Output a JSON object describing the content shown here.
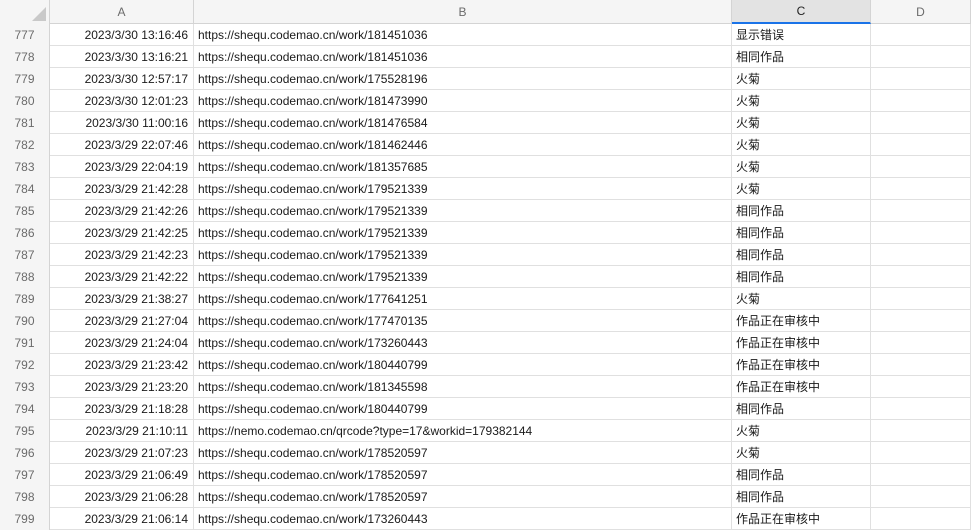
{
  "columns": [
    "A",
    "B",
    "C",
    "D"
  ],
  "rows": [
    {
      "num": "777",
      "a": "2023/3/30 13:16:46",
      "b": "https://shequ.codemao.cn/work/181451036",
      "c": "显示错误"
    },
    {
      "num": "778",
      "a": "2023/3/30 13:16:21",
      "b": "https://shequ.codemao.cn/work/181451036",
      "c": "相同作品"
    },
    {
      "num": "779",
      "a": "2023/3/30 12:57:17",
      "b": "https://shequ.codemao.cn/work/175528196",
      "c": "火菊"
    },
    {
      "num": "780",
      "a": "2023/3/30 12:01:23",
      "b": "https://shequ.codemao.cn/work/181473990",
      "c": "火菊"
    },
    {
      "num": "781",
      "a": "2023/3/30 11:00:16",
      "b": "https://shequ.codemao.cn/work/181476584",
      "c": "火菊"
    },
    {
      "num": "782",
      "a": "2023/3/29 22:07:46",
      "b": "https://shequ.codemao.cn/work/181462446",
      "c": "火菊"
    },
    {
      "num": "783",
      "a": "2023/3/29 22:04:19",
      "b": "https://shequ.codemao.cn/work/181357685",
      "c": "火菊"
    },
    {
      "num": "784",
      "a": "2023/3/29 21:42:28",
      "b": "https://shequ.codemao.cn/work/179521339",
      "c": "火菊"
    },
    {
      "num": "785",
      "a": "2023/3/29 21:42:26",
      "b": "https://shequ.codemao.cn/work/179521339",
      "c": "相同作品"
    },
    {
      "num": "786",
      "a": "2023/3/29 21:42:25",
      "b": "https://shequ.codemao.cn/work/179521339",
      "c": "相同作品"
    },
    {
      "num": "787",
      "a": "2023/3/29 21:42:23",
      "b": "https://shequ.codemao.cn/work/179521339",
      "c": "相同作品"
    },
    {
      "num": "788",
      "a": "2023/3/29 21:42:22",
      "b": "https://shequ.codemao.cn/work/179521339",
      "c": "相同作品"
    },
    {
      "num": "789",
      "a": "2023/3/29 21:38:27",
      "b": "https://shequ.codemao.cn/work/177641251",
      "c": "火菊"
    },
    {
      "num": "790",
      "a": "2023/3/29 21:27:04",
      "b": "https://shequ.codemao.cn/work/177470135",
      "c": "作品正在审核中"
    },
    {
      "num": "791",
      "a": "2023/3/29 21:24:04",
      "b": "https://shequ.codemao.cn/work/173260443",
      "c": "作品正在审核中"
    },
    {
      "num": "792",
      "a": "2023/3/29 21:23:42",
      "b": "https://shequ.codemao.cn/work/180440799",
      "c": "作品正在审核中"
    },
    {
      "num": "793",
      "a": "2023/3/29 21:23:20",
      "b": "https://shequ.codemao.cn/work/181345598",
      "c": "作品正在审核中"
    },
    {
      "num": "794",
      "a": "2023/3/29 21:18:28",
      "b": "https://shequ.codemao.cn/work/180440799",
      "c": "相同作品"
    },
    {
      "num": "795",
      "a": "2023/3/29 21:10:11",
      "b": "https://nemo.codemao.cn/qrcode?type=17&workid=179382144",
      "c": "火菊"
    },
    {
      "num": "796",
      "a": "2023/3/29 21:07:23",
      "b": "https://shequ.codemao.cn/work/178520597",
      "c": "火菊"
    },
    {
      "num": "797",
      "a": "2023/3/29 21:06:49",
      "b": "https://shequ.codemao.cn/work/178520597",
      "c": "相同作品"
    },
    {
      "num": "798",
      "a": "2023/3/29 21:06:28",
      "b": "https://shequ.codemao.cn/work/178520597",
      "c": "相同作品"
    },
    {
      "num": "799",
      "a": "2023/3/29 21:06:14",
      "b": "https://shequ.codemao.cn/work/173260443",
      "c": "作品正在审核中"
    }
  ]
}
